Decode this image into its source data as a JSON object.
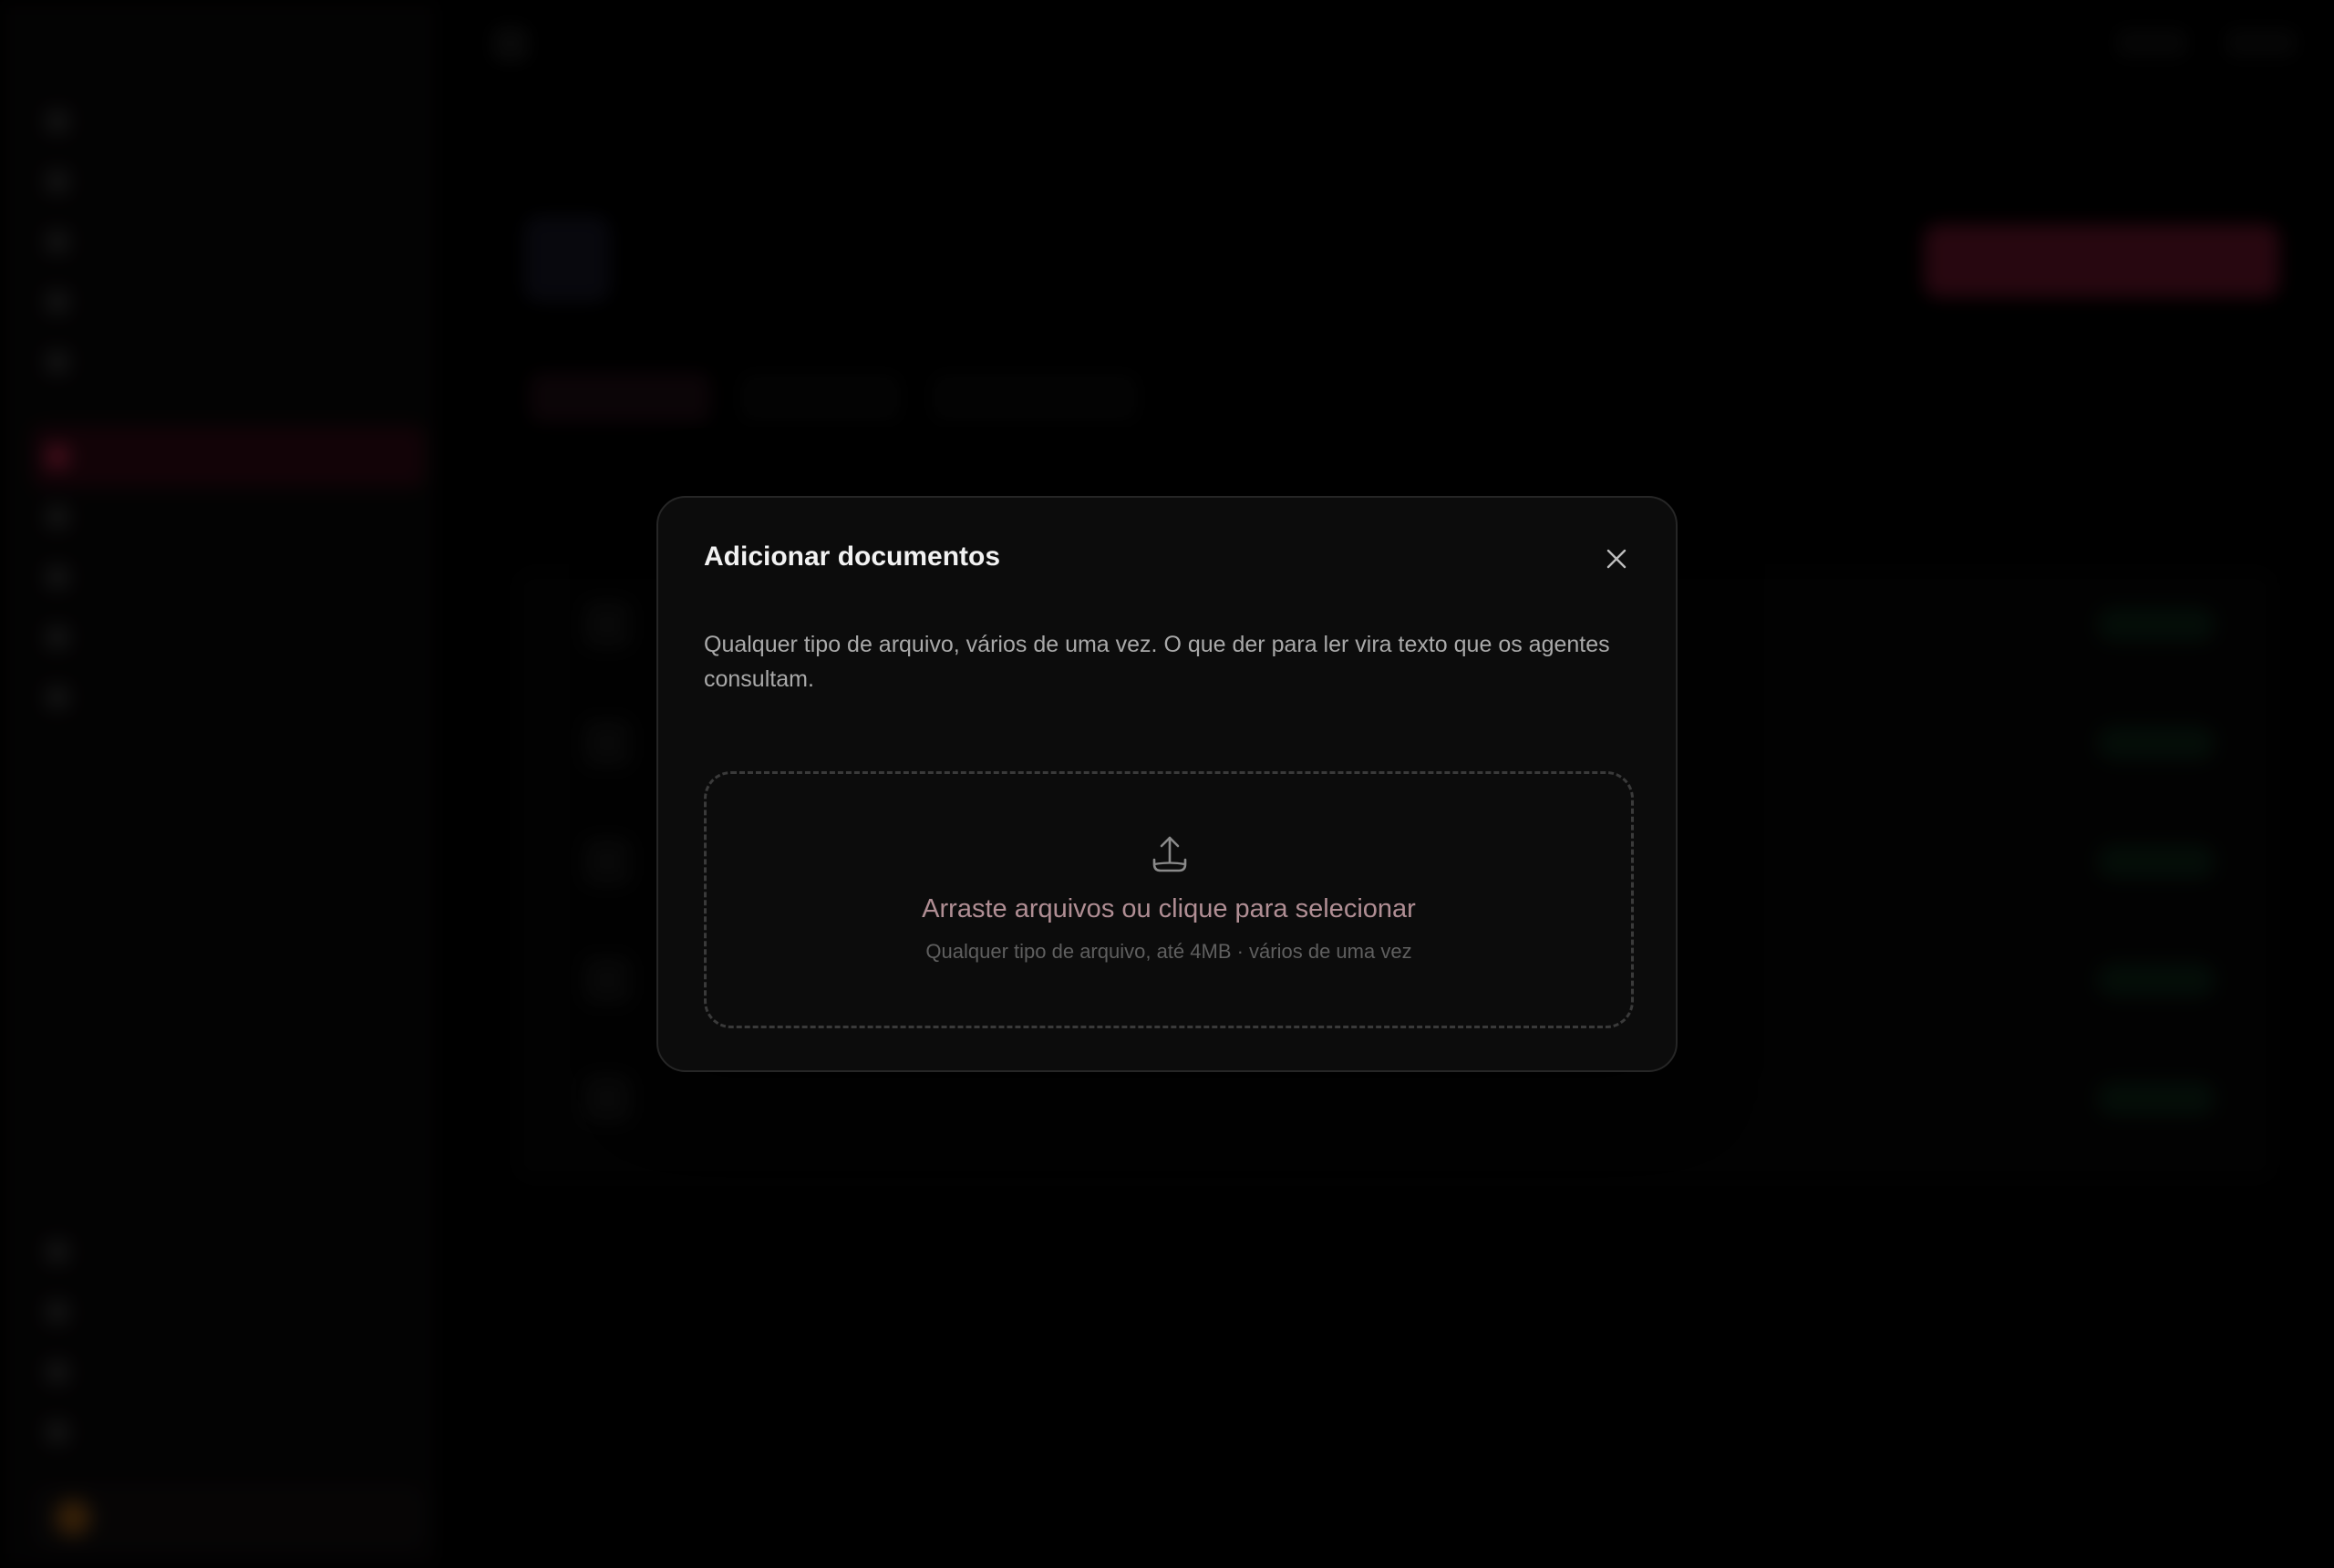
{
  "modal": {
    "title": "Adicionar documentos",
    "description": "Qualquer tipo de arquivo, vários de uma vez. O que der para ler vira texto que os agentes consultam.",
    "dropzone": {
      "primary_text": "Arraste arquivos ou clique para selecionar",
      "secondary_text": "Qualquer tipo de arquivo, até 4MB · vários de uma vez",
      "icon": "upload-icon"
    },
    "close_icon": "close-icon"
  },
  "colors": {
    "accent": "#c0284e",
    "modal_bg": "#0c0c0c",
    "dropzone_text": "#b08e94"
  }
}
